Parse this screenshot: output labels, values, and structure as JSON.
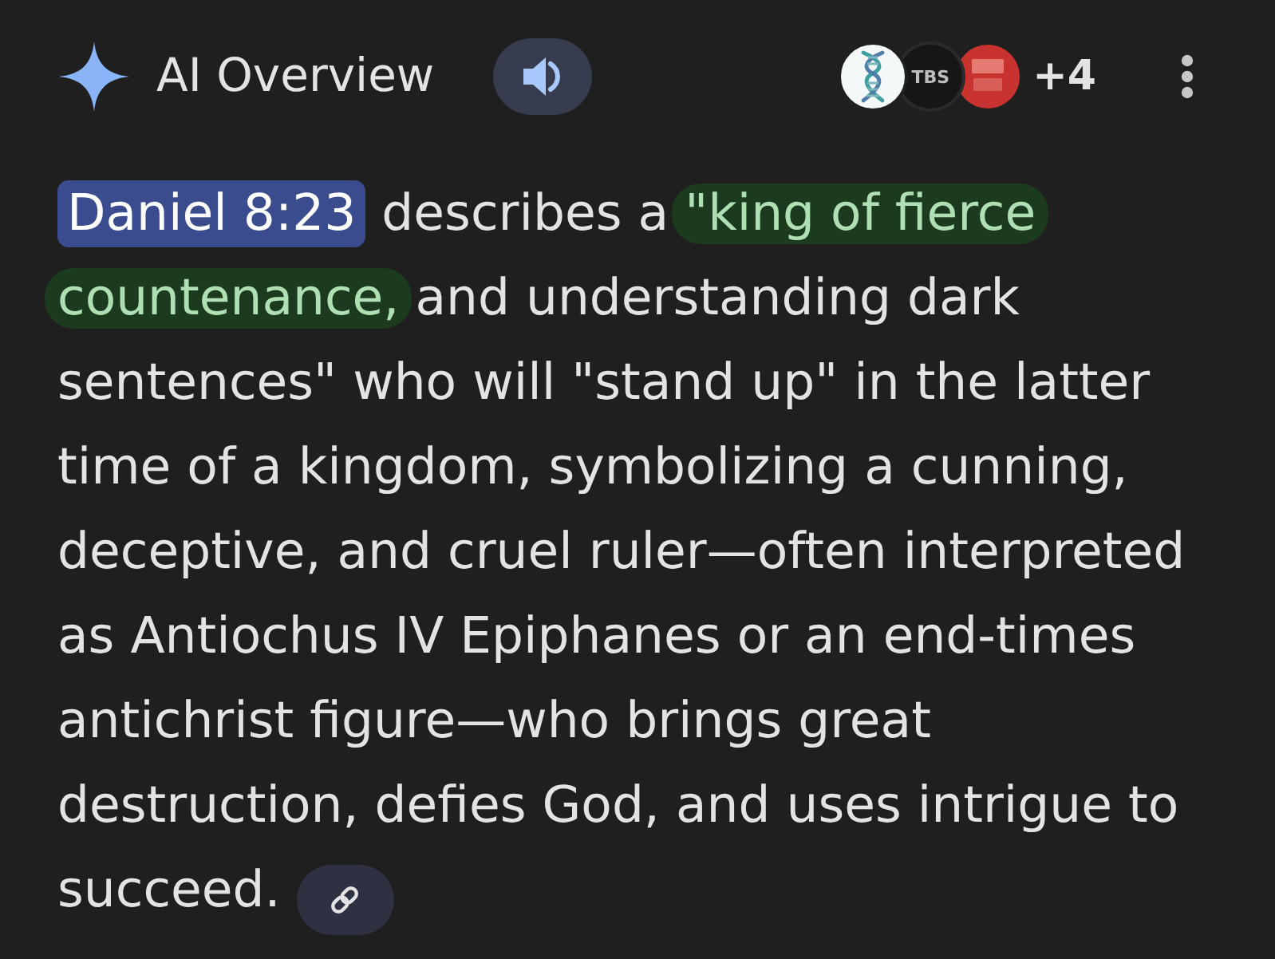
{
  "header": {
    "title": "AI Overview"
  },
  "sources": {
    "logos": [
      {
        "kind": "dna"
      },
      {
        "kind": "tbs",
        "label": "TBS"
      },
      {
        "kind": "emblem"
      }
    ],
    "more_count": "+4"
  },
  "answer": {
    "segments": [
      {
        "kind": "citation",
        "text": "Daniel 8:23"
      },
      {
        "kind": "text",
        "text": " describes a "
      },
      {
        "kind": "highlight",
        "text": "\"king of fierce countenance,"
      },
      {
        "kind": "text",
        "text": " and understanding dark sentences\" who will \"stand up\" in the latter time of a kingdom, symbolizing a cunning, deceptive, and cruel ruler—often interpreted as Antiochus IV Epiphanes or an end-times antichrist figure—who brings great destruction, defies God, and uses intrigue to succeed."
      }
    ]
  }
}
